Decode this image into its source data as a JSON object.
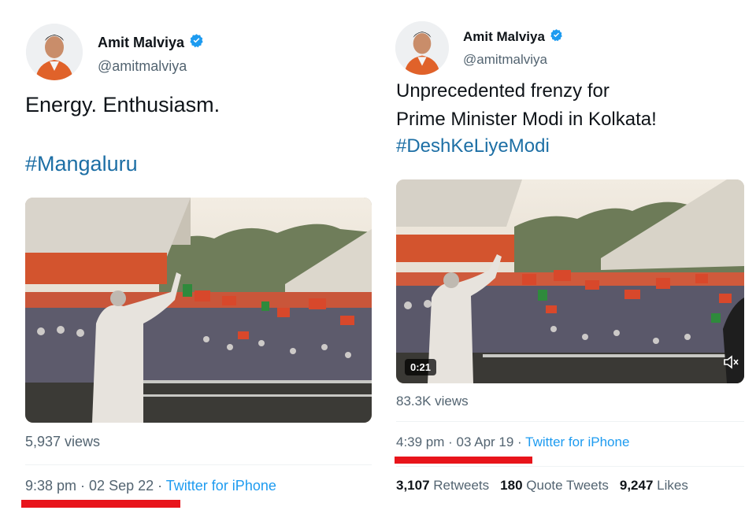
{
  "left_tweet": {
    "author_name": "Amit Malviya",
    "handle": "@amitmalviya",
    "text": "Energy. Enthusiasm.",
    "hashtag": "#Mangaluru",
    "views": "5,937 views",
    "time": "9:38 pm",
    "separator": " · ",
    "date": "02 Sep 22",
    "client": "Twitter for iPhone"
  },
  "right_tweet": {
    "author_name": "Amit Malviya",
    "handle": "@amitmalviya",
    "text_line1": "Unprecedented frenzy for",
    "text_line2": "Prime Minister Modi in Kolkata!",
    "hashtag": "#DeshKeLiyeModi",
    "video_duration": "0:21",
    "views": "83.3K views",
    "time": "4:39 pm",
    "separator": " · ",
    "date": "03 Apr 19",
    "client": "Twitter for iPhone",
    "retweets_count": "3,107",
    "retweets_label": "Retweets",
    "quote_count": "180",
    "quote_label": "Quote Tweets",
    "likes_count": "9,247",
    "likes_label": "Likes"
  },
  "colors": {
    "hashtag": "#1d6fa5",
    "client_link": "#1d9bf0",
    "verified": "#1d9bf0",
    "underline": "#e8141b"
  },
  "icons": [
    "verified-badge-icon",
    "mute-icon"
  ]
}
